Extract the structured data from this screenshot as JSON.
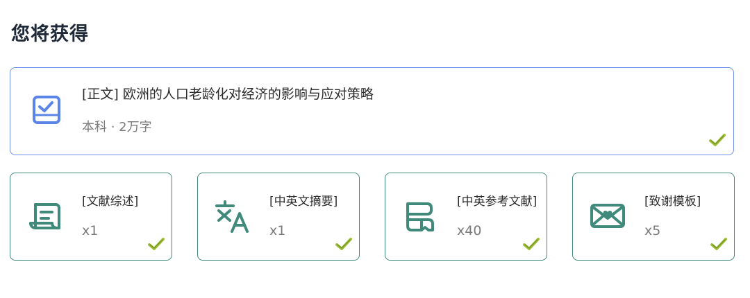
{
  "page_title": "您将获得",
  "colors": {
    "main_border": "#6d8ee8",
    "secondary_border": "#3f8a7a",
    "main_icon": "#5b84e7",
    "secondary_icon": "#3f8a7a",
    "check": "#9fbf39"
  },
  "main_item": {
    "title": "[正文] 欧洲的人口老龄化对经济的影响与应对策略",
    "meta": "本科 · 2万字",
    "icon": "checked-document-icon"
  },
  "items": [
    {
      "label": "[文献综述]",
      "count": "x1",
      "icon": "scroll-document-icon"
    },
    {
      "label": "[中英文摘要]",
      "count": "x1",
      "icon": "translate-icon"
    },
    {
      "label": "[中英参考文献]",
      "count": "x40",
      "icon": "bookmark-reference-icon"
    },
    {
      "label": "[致谢模板]",
      "count": "x5",
      "icon": "envelope-heart-icon"
    }
  ]
}
